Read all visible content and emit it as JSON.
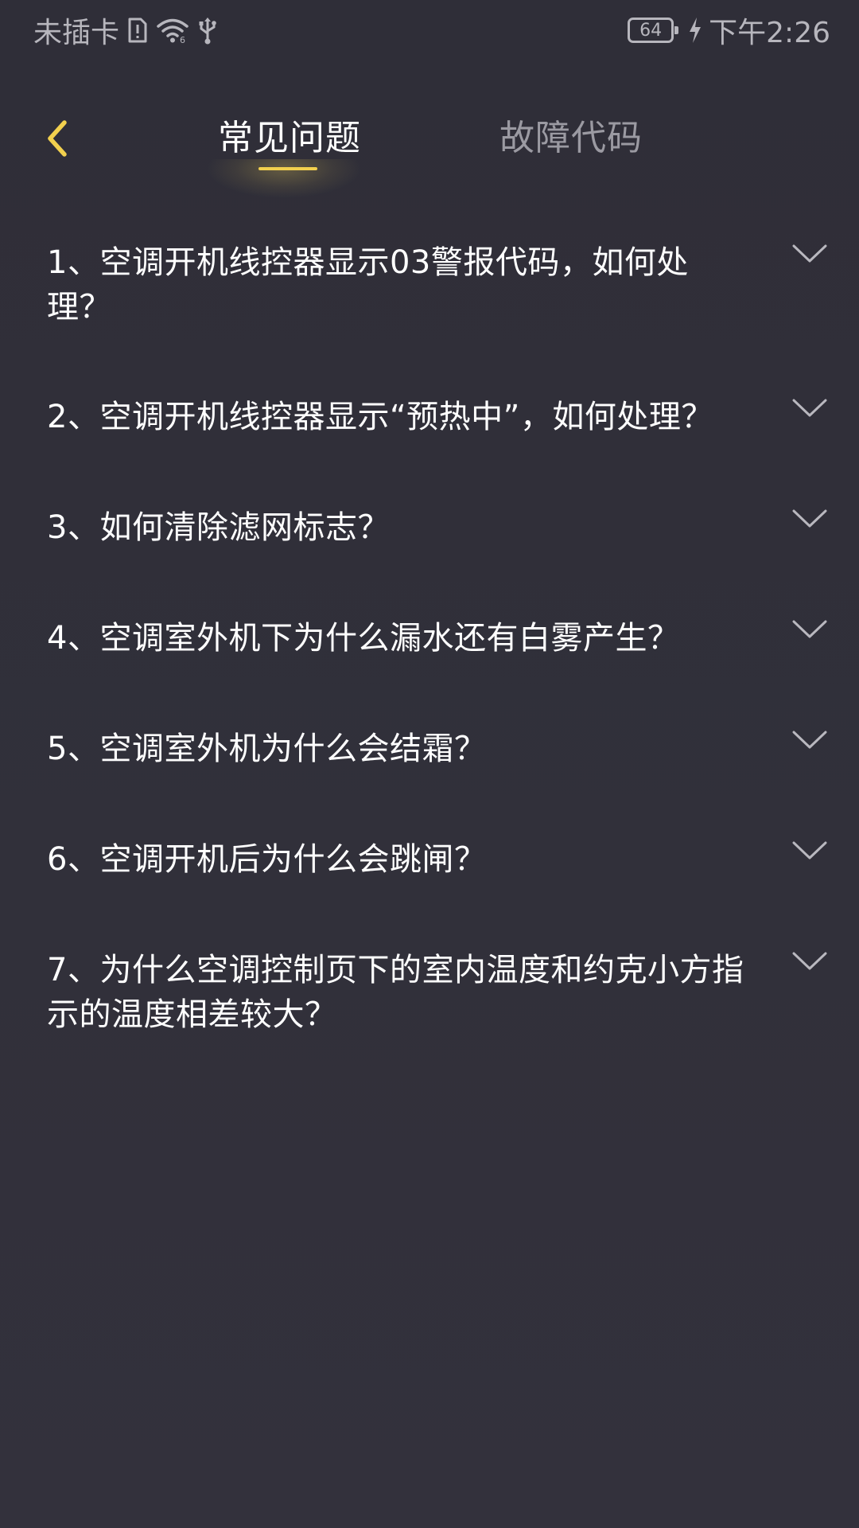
{
  "status_bar": {
    "carrier": "未插卡",
    "battery_level": "64",
    "time": "下午2:26",
    "icons": [
      "sim-card-icon",
      "wifi-icon",
      "usb-icon",
      "battery-icon",
      "charging-bolt-icon"
    ]
  },
  "header": {
    "back_icon": "chevron-left-icon",
    "tabs": [
      {
        "label": "常见问题",
        "active": true
      },
      {
        "label": "故障代码",
        "active": false
      }
    ]
  },
  "faq": {
    "items": [
      {
        "question": "1、空调开机线控器显示03警报代码，如何处理？"
      },
      {
        "question": "2、空调开机线控器显示“预热中”，如何处理？"
      },
      {
        "question": "3、如何清除滤网标志？"
      },
      {
        "question": "4、空调室外机下为什么漏水还有白雾产生？"
      },
      {
        "question": "5、空调室外机为什么会结霜？"
      },
      {
        "question": "6、空调开机后为什么会跳闸？"
      },
      {
        "question": "7、为什么空调控制页下的室内温度和约克小方指示的温度相差较大？"
      }
    ],
    "expand_icon": "chevron-down-icon"
  },
  "colors": {
    "background": "#312f3a",
    "accent": "#f2d04e",
    "text_primary": "#ffffff",
    "text_secondary": "#9b9aa2"
  }
}
